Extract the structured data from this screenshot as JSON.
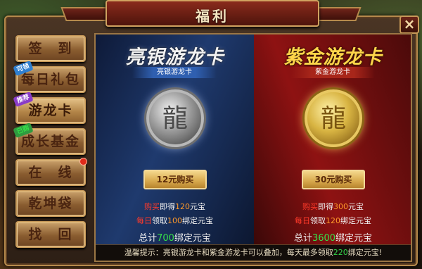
{
  "window": {
    "title": "福利",
    "close_label": "×"
  },
  "sidebar": {
    "items": [
      {
        "label": "签　到",
        "tag": "",
        "tag_color": "",
        "dot": false,
        "active": false
      },
      {
        "label": "每日礼包",
        "tag": "可领",
        "tag_color": "blue",
        "dot": false,
        "active": false
      },
      {
        "label": "游龙卡",
        "tag": "推荐",
        "tag_color": "purple",
        "dot": false,
        "active": true
      },
      {
        "label": "成长基金",
        "tag": "已购",
        "tag_color": "green",
        "dot": false,
        "active": false
      },
      {
        "label": "在　线",
        "tag": "",
        "tag_color": "",
        "dot": true,
        "active": false
      },
      {
        "label": "乾坤袋",
        "tag": "",
        "tag_color": "",
        "dot": false,
        "active": false
      },
      {
        "label": "找　回",
        "tag": "",
        "tag_color": "",
        "dot": false,
        "active": false
      }
    ]
  },
  "cards": {
    "silver": {
      "title": "亮银游龙卡",
      "ribbon": "亮银游龙卡",
      "buy_label": "12元购买",
      "line1_a": "购买",
      "line1_b": "即得",
      "line1_c": "120",
      "line1_d": "元宝",
      "line2_a": "每日",
      "line2_b": "领取",
      "line2_c": "100",
      "line2_d": "绑定元宝",
      "line3_a": "总计",
      "line3_b": "700",
      "line3_c": "绑定元宝"
    },
    "gold": {
      "title": "紫金游龙卡",
      "ribbon": "紫金游龙卡",
      "buy_label": "30元购买",
      "line1_a": "购买",
      "line1_b": "即得",
      "line1_c": "300",
      "line1_d": "元宝",
      "line2_a": "每日",
      "line2_b": "领取",
      "line2_c": "120",
      "line2_d": "绑定元宝",
      "line3_a": "总计",
      "line3_b": "3600",
      "line3_c": "绑定元宝"
    }
  },
  "tip": {
    "prefix": "温馨提示：亮银游龙卡和紫金游龙卡可以叠加，每天最多领取",
    "amount": "220",
    "suffix": "绑定元宝!"
  },
  "icons": {
    "coin_silver": "dragon-emblem",
    "coin_gold": "dragon-emblem"
  }
}
